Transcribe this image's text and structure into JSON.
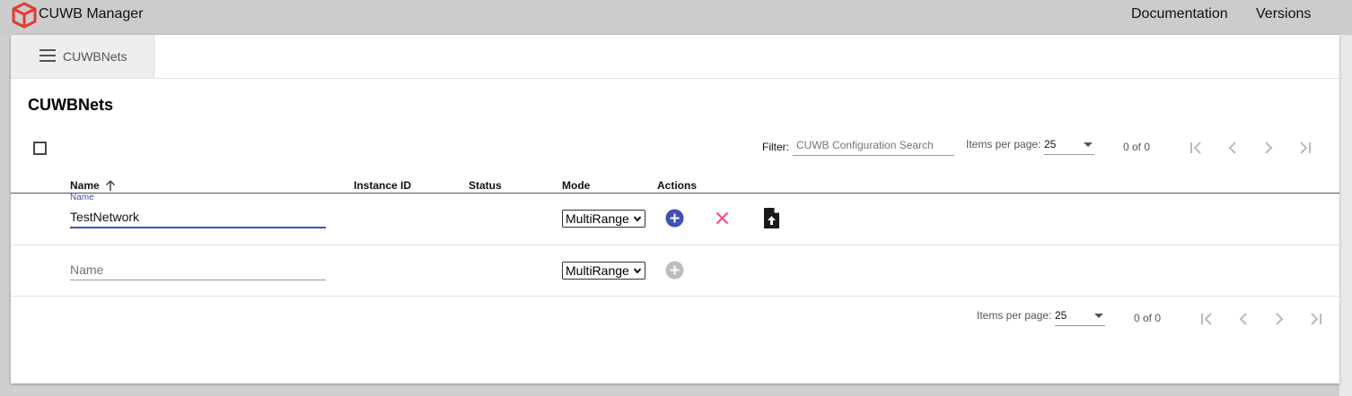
{
  "app": {
    "title": "CUWB Manager",
    "logo_icon": "cube-logo-icon",
    "brand_color": "#e53935"
  },
  "nav": {
    "documentation": "Documentation",
    "versions": "Versions"
  },
  "tabbar": {
    "menu_label": "CUWBNets",
    "menu_icon": "hamburger-menu-icon"
  },
  "page": {
    "title": "CUWBNets"
  },
  "toolbar": {
    "filter_label": "Filter:",
    "filter_placeholder": "CUWB Configuration Search",
    "items_per_page_label": "Items per page:",
    "items_per_page_value": "25",
    "range_label": "0 of 0"
  },
  "table": {
    "columns": {
      "name": "Name",
      "instance_id": "Instance ID",
      "status": "Status",
      "mode": "Mode",
      "actions": "Actions"
    },
    "sort": {
      "column": "name",
      "direction": "asc",
      "icon": "arrow-up-icon"
    },
    "edit_row": {
      "name_float_label": "Name",
      "name_value": "TestNetwork",
      "mode_value": "MultiRange",
      "actions": [
        "add-circle-icon",
        "close-icon",
        "file-upload-icon"
      ]
    },
    "new_row": {
      "name_placeholder": "Name",
      "mode_value": "MultiRange",
      "actions": [
        "add-circle-icon"
      ]
    }
  },
  "bottom_paginator": {
    "items_per_page_label": "Items per page:",
    "items_per_page_value": "25",
    "range_label": "0 of 0"
  },
  "colors": {
    "accent": "#3f51b5",
    "warn": "#ff4081",
    "disabled": "#bdbdbd"
  }
}
